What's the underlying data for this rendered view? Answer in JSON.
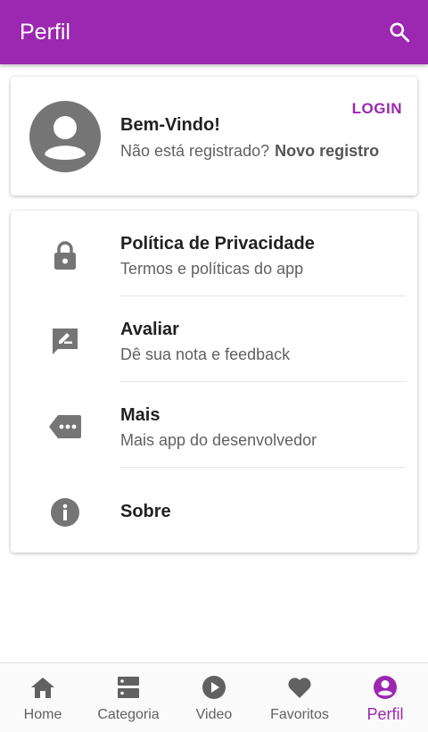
{
  "appbar": {
    "title": "Perfil",
    "search_icon": "search-icon"
  },
  "profile": {
    "welcome": "Bem-Vindo!",
    "not_registered": "Não está registrado?",
    "new_register": "Novo registro",
    "login": "LOGIN",
    "avatar_icon": "account-circle-icon"
  },
  "menu": {
    "items": [
      {
        "title": "Política de Privacidade",
        "desc": "Termos e políticas do app",
        "icon": "lock-icon"
      },
      {
        "title": "Avaliar",
        "desc": "Dê sua nota e feedback",
        "icon": "rate-review-icon"
      },
      {
        "title": "Mais",
        "desc": "Mais app do desenvolvedor",
        "icon": "more-label-icon"
      },
      {
        "title": "Sobre",
        "icon": "info-icon"
      }
    ]
  },
  "bottom_nav": {
    "items": [
      {
        "label": "Home",
        "icon": "home-icon"
      },
      {
        "label": "Categoria",
        "icon": "category-icon"
      },
      {
        "label": "Video",
        "icon": "play-circle-icon"
      },
      {
        "label": "Favoritos",
        "icon": "heart-icon"
      },
      {
        "label": "Perfil",
        "icon": "account-circle-icon",
        "active": true
      }
    ]
  },
  "colors": {
    "primary": "#9c27b0",
    "icon_gray": "#757575",
    "text_primary": "#212121",
    "text_secondary": "#616161"
  }
}
